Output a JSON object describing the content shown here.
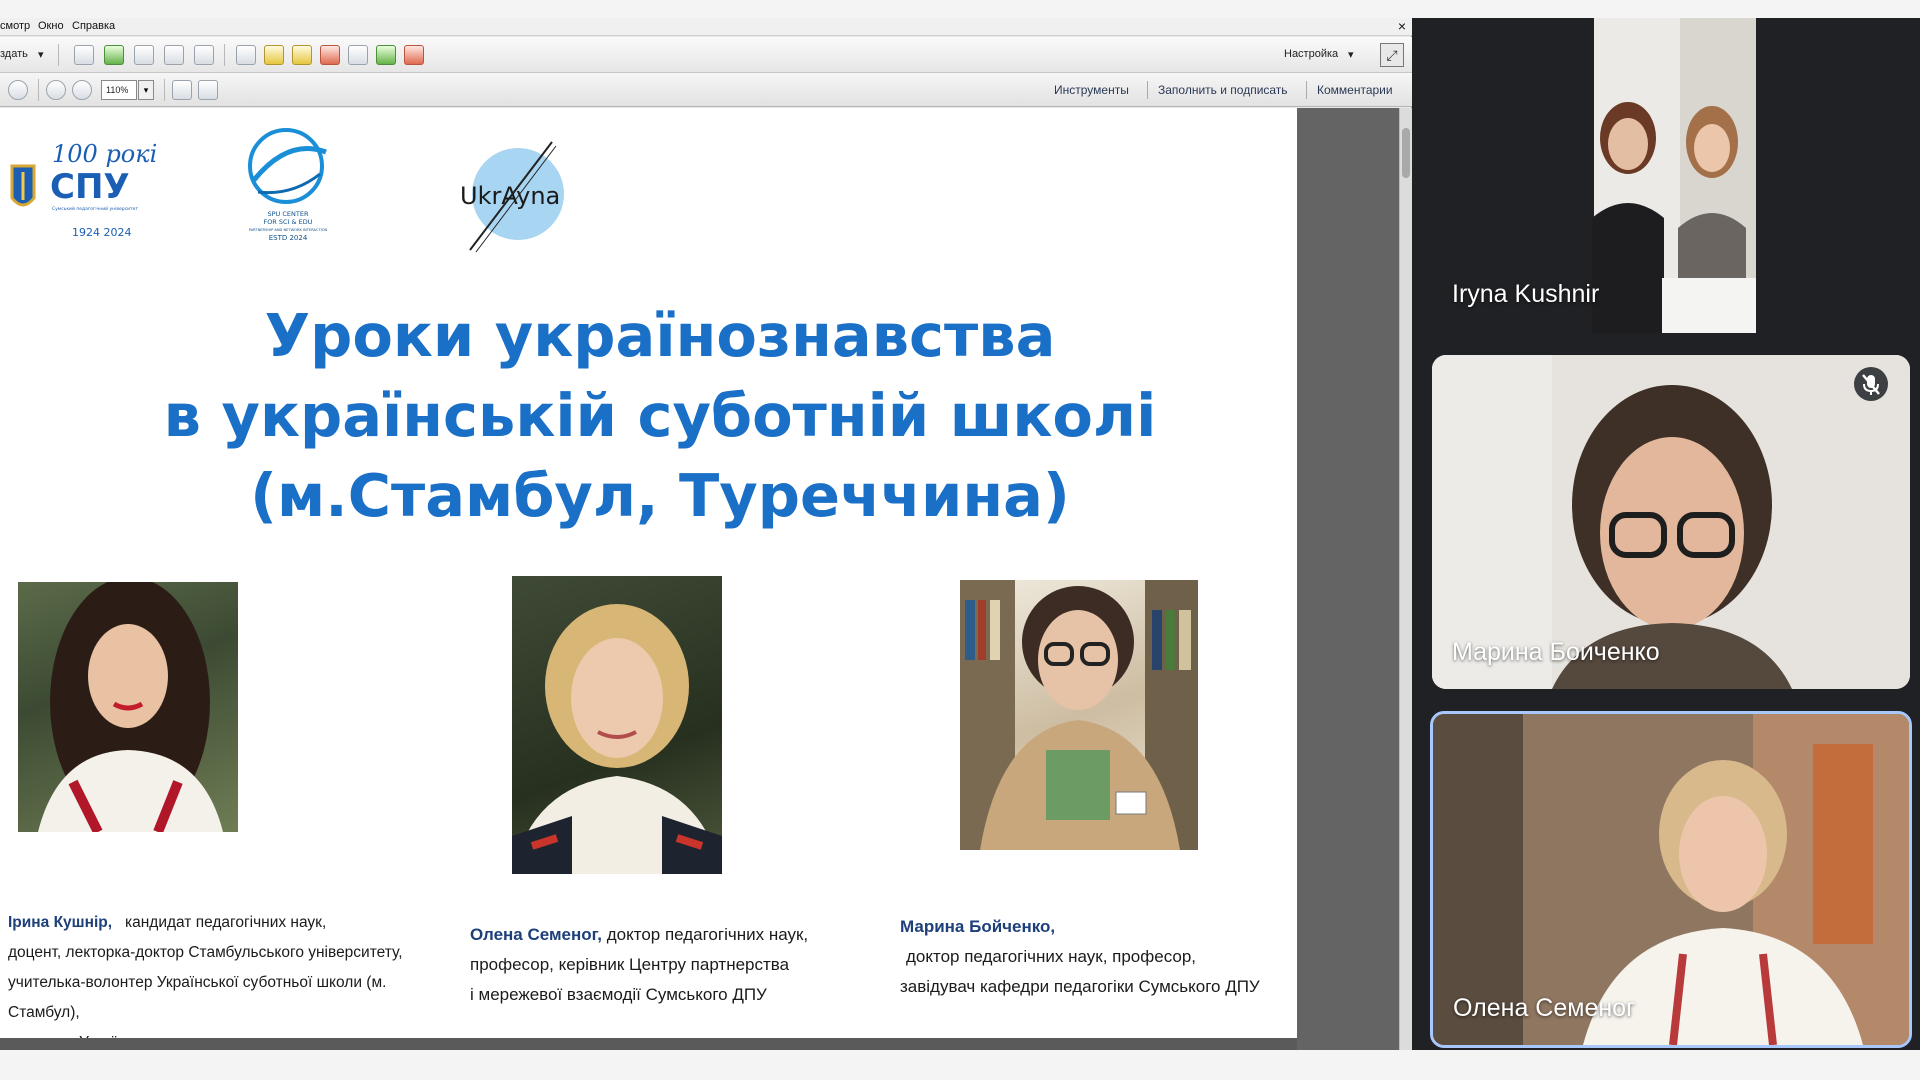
{
  "menu": {
    "items": [
      "смотр",
      "Окно",
      "Справка"
    ]
  },
  "toolbar": {
    "create_label": "здать",
    "create_arrow": "▾",
    "settings_label": "Настройка",
    "settings_arrow": "▾",
    "zoom_value": "110%",
    "zoom_arrow": "▾",
    "panels": [
      "Инструменты",
      "Заполнить и подписать",
      "Комментарии"
    ],
    "expand_glyph": "⤢",
    "close_glyph": "×"
  },
  "slide": {
    "logo_spu": {
      "years": "100 років",
      "name": "СПУ",
      "dates": "1924 2024",
      "tagline": "Сумський педагогічний університет"
    },
    "logo_center": {
      "line1": "SPU CENTER",
      "line2": "FOR SCI & EDU",
      "line3": "PARTNERSHIP AND NETWORK INTERACTION",
      "line4": "ESTD 2024"
    },
    "logo_ukr": {
      "text": "UkrAyna"
    },
    "title_lines": [
      "Уроки українознавства",
      "в українській суботній школі",
      "(м.Стамбул, Туреччина)"
    ],
    "captions": [
      {
        "name": "Ірина Кушнір,",
        "lines": [
          "кандидат педагогічних наук,",
          "доцент, лекторка-доктор Стамбульського університету,",
          "учителька-волонтер Української суботньої школи (м. Стамбул),",
          "членкиня Українського товариства взаємодопомоги в Стамбулі"
        ]
      },
      {
        "name": "Олена Семеног,",
        "lines": [
          "доктор педагогічних наук,",
          "професор, керівник Центру партнерства",
          "і мережевої взаємодії Сумського ДПУ"
        ]
      },
      {
        "name": "Марина Бойченко,",
        "lines": [
          "доктор педагогічних наук, професор,",
          "завідувач кафедри педагогіки Сумського ДПУ"
        ]
      }
    ]
  },
  "participants": [
    {
      "name": "Iryna Kushnir"
    },
    {
      "name": "Марина Боиченко",
      "muted": true
    },
    {
      "name": "Олена Семеног",
      "active": true
    }
  ],
  "colors": {
    "title": "#1a6fc6",
    "caption_name": "#1d3f7a",
    "meet_bg": "#202124",
    "active_border": "#a8c7fa"
  }
}
